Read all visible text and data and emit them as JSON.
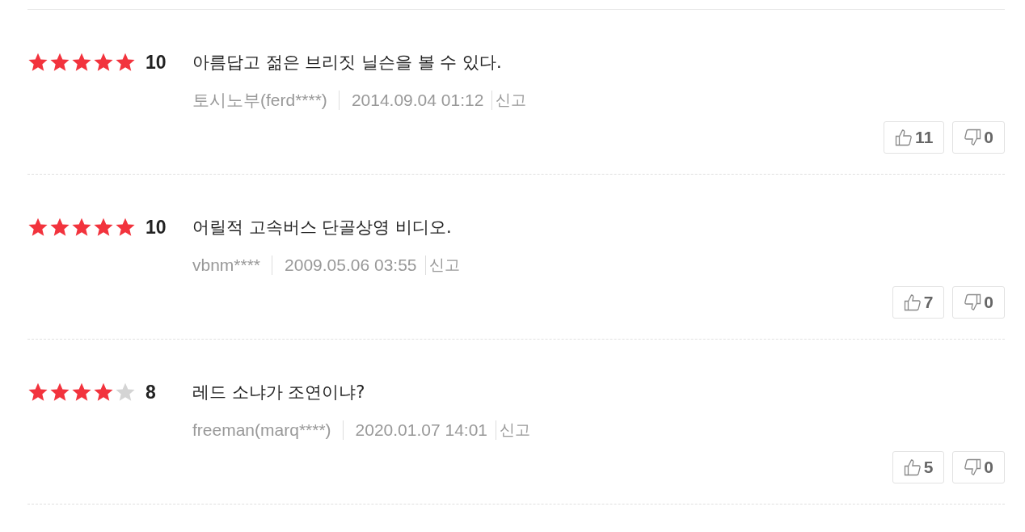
{
  "reviews": [
    {
      "stars": 5,
      "score": "10",
      "text": "아름답고 젊은 브리짓 닐슨을 볼 수 있다.",
      "author": "토시노부(ferd****)",
      "date": "2014.09.04 01:12",
      "report": "신고",
      "likes": "11",
      "dislikes": "0"
    },
    {
      "stars": 5,
      "score": "10",
      "text": "어릴적 고속버스 단골상영 비디오.",
      "author": "vbnm****",
      "date": "2009.05.06 03:55",
      "report": "신고",
      "likes": "7",
      "dislikes": "0"
    },
    {
      "stars": 4,
      "score": "8",
      "text": "레드 소냐가 조연이냐?",
      "author": "freeman(marq****)",
      "date": "2020.01.07 14:01",
      "report": "신고",
      "likes": "5",
      "dislikes": "0"
    }
  ]
}
